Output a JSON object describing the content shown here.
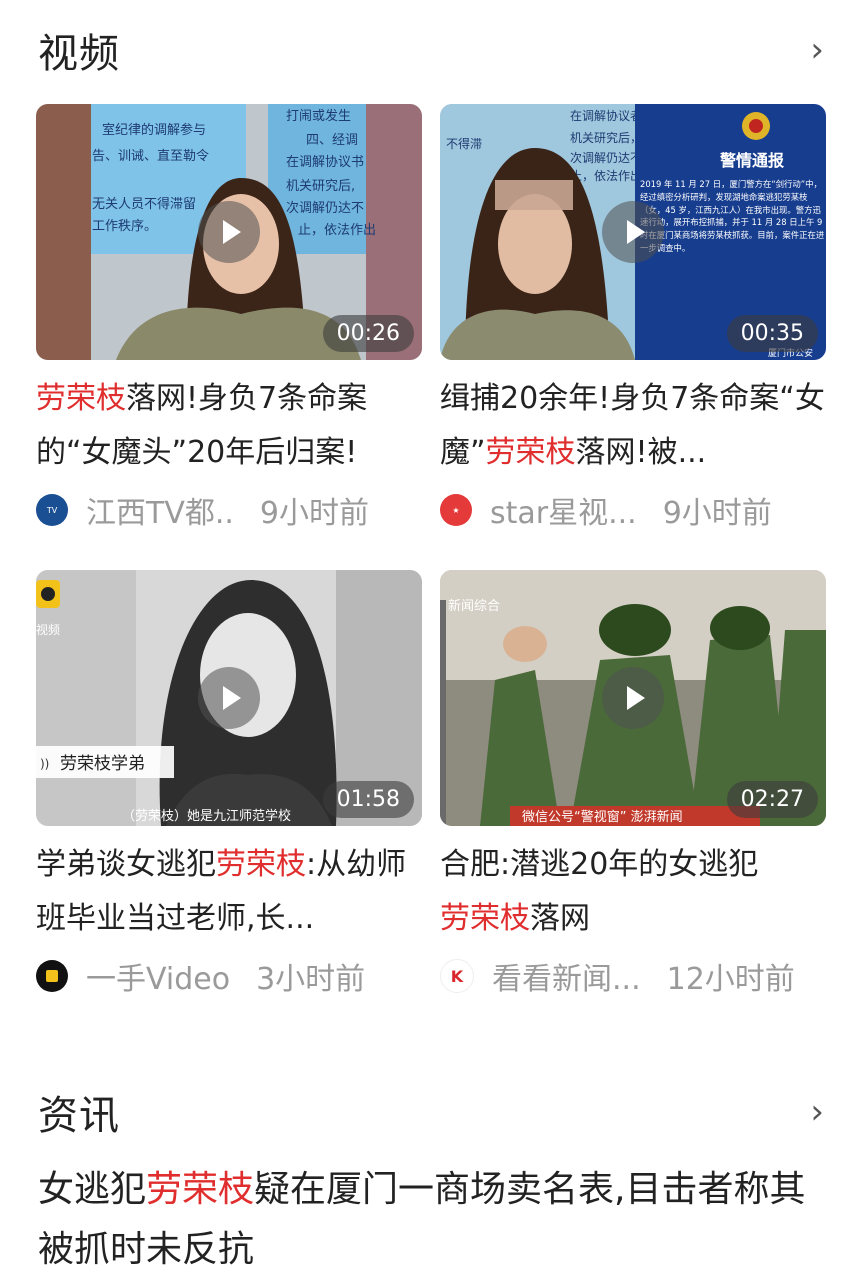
{
  "videos": {
    "header": {
      "title": "视频",
      "more_icon": "chevron-right-icon"
    },
    "items": [
      {
        "title_hl": "劳荣枝",
        "title_rest": "落网!身负7条命案的“女魔头”20年后归案!",
        "duration": "00:26",
        "source": "江西TV都..",
        "time": "9小时前",
        "avatar_color": "#1b4f93"
      },
      {
        "title_pre": "缉捕20余年!身负7条命案“女魔”",
        "title_hl": "劳荣枝",
        "title_post": "落网!被...",
        "duration": "00:35",
        "source": "star星视...",
        "time": "9小时前",
        "avatar_color": "#e43a3a",
        "overlay": {
          "heading": "警情通报",
          "body": "2019 年 11 月 27 日，厦门警方在“剑行动”中，经过缜密分析研判，发现湖地命案逃犯劳某枝（女，45 岁，江西九江人）在我市出现。警方迅速行动，展开布控抓捕，并于 11 月 28 日上午 9时在厦门某商场将劳某枝抓获。目前，案件正在进一步调查中。",
          "footer": "厦门市公安"
        }
      },
      {
        "title_pre": "学弟谈女逃犯",
        "title_hl": "劳荣枝",
        "title_post": ":从幼师班毕业当过老师,长...",
        "duration": "01:58",
        "source": "一手Video",
        "time": "3小时前",
        "avatar_color": "#111111",
        "overlay": {
          "label": "劳荣枝学弟",
          "caption": "（劳荣枝）她是九江师范学校",
          "brand": "视频"
        }
      },
      {
        "title_pre": "合肥:潜逃20年的女逃犯",
        "title_hl": "劳荣枝",
        "title_post": "落网",
        "duration": "02:27",
        "source": "看看新闻...",
        "time": "12小时前",
        "avatar_color": "#d9262c",
        "overlay": {
          "brand": "新闻综合",
          "ticker": "微信公号“警视窗” 澎湃新闻"
        }
      }
    ]
  },
  "news": {
    "header": {
      "title": "资讯",
      "more_icon": "chevron-right-icon"
    },
    "item": {
      "title_pre": "女逃犯",
      "title_hl": "劳荣枝",
      "title_post": "疑在厦门一商场卖名表,目击者称其被抓时未反抗"
    }
  },
  "colors": {
    "highlight": "#e02d2d",
    "meta": "#9a9a9a"
  }
}
